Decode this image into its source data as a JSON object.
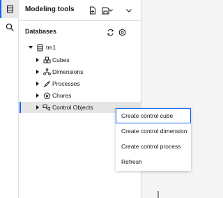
{
  "panel": {
    "title": "Modeling tools"
  },
  "databases": {
    "title": "Databases",
    "server": "tm1",
    "items": [
      {
        "label": "Cubes",
        "icon": "cube-icon"
      },
      {
        "label": "Dimensions",
        "icon": "hierarchy-icon"
      },
      {
        "label": "Processes",
        "icon": "process-icon"
      },
      {
        "label": "Chores",
        "icon": "chore-icon"
      },
      {
        "label": "Control Objects",
        "icon": "control-objects-icon"
      }
    ]
  },
  "context_menu": {
    "items": [
      "Create control cube",
      "Create control dimension",
      "Create control process",
      "Refresh"
    ]
  },
  "colors": {
    "accent": "#0f62fe",
    "selected_row": "#e5e5e5",
    "text": "#161616"
  }
}
